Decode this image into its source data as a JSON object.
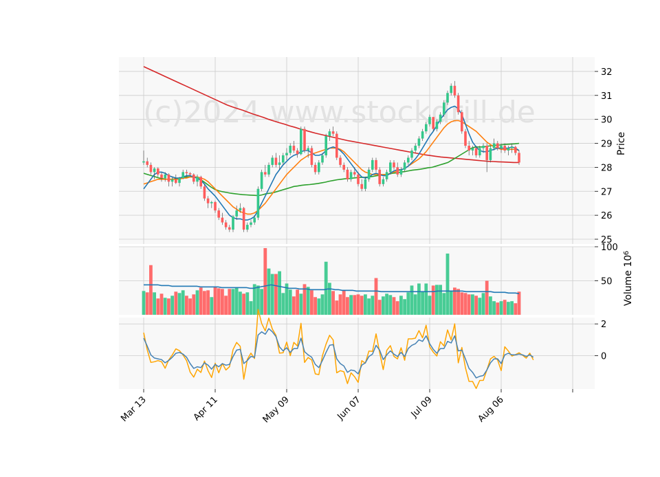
{
  "chart_data": {
    "type": "candlestick",
    "watermark": "(c)2024 www.stockdrill.de",
    "x_tick_labels": [
      "Mar 13",
      "Apr 11",
      "May 09",
      "Jun 07",
      "Jul 09",
      "Aug 06"
    ],
    "x_tick_index": [
      0,
      20,
      40,
      60,
      80,
      100,
      120
    ],
    "colors": {
      "up": "#34c78a",
      "down": "#ff5c5c",
      "ma_short": "#1f77b4",
      "ma_mid": "#ff7f0e",
      "ma_long": "#2ca02c",
      "ma_200": "#d62728",
      "vol_ma": "#1f77b4",
      "osc_a": "#4682b4",
      "osc_b": "#ffa500"
    },
    "price_panel": {
      "ylabel": "Price",
      "ylim": [
        24.8,
        32.6
      ],
      "yticks": [
        25,
        26,
        27,
        28,
        29,
        30,
        31,
        32
      ],
      "candles_ohlc": [
        [
          28.2,
          28.7,
          28.1,
          28.25
        ],
        [
          28.25,
          28.4,
          28.0,
          28.1
        ],
        [
          28.1,
          28.2,
          27.7,
          27.8
        ],
        [
          27.8,
          28.0,
          27.5,
          27.95
        ],
        [
          27.95,
          28.0,
          27.6,
          27.7
        ],
        [
          27.7,
          27.8,
          27.4,
          27.55
        ],
        [
          27.55,
          27.8,
          27.4,
          27.7
        ],
        [
          27.7,
          27.75,
          27.2,
          27.4
        ],
        [
          27.4,
          27.6,
          27.2,
          27.5
        ],
        [
          27.5,
          27.7,
          27.3,
          27.35
        ],
        [
          27.35,
          27.6,
          27.2,
          27.55
        ],
        [
          27.55,
          27.9,
          27.5,
          27.8
        ],
        [
          27.8,
          27.9,
          27.6,
          27.75
        ],
        [
          27.75,
          27.8,
          27.6,
          27.7
        ],
        [
          27.7,
          27.75,
          27.3,
          27.4
        ],
        [
          27.4,
          27.7,
          27.2,
          27.6
        ],
        [
          27.6,
          27.65,
          27.1,
          27.2
        ],
        [
          27.2,
          27.3,
          26.6,
          26.7
        ],
        [
          26.7,
          26.8,
          26.3,
          26.5
        ],
        [
          26.5,
          26.6,
          26.3,
          26.55
        ],
        [
          26.55,
          26.6,
          26.1,
          26.2
        ],
        [
          26.2,
          26.3,
          25.8,
          25.9
        ],
        [
          25.9,
          26.1,
          25.6,
          25.7
        ],
        [
          25.7,
          25.8,
          25.4,
          25.5
        ],
        [
          25.5,
          25.6,
          25.3,
          25.4
        ],
        [
          25.4,
          26.0,
          25.3,
          25.95
        ],
        [
          25.95,
          26.4,
          25.8,
          26.2
        ],
        [
          26.2,
          26.5,
          26.1,
          26.3
        ],
        [
          26.3,
          26.35,
          25.3,
          25.4
        ],
        [
          25.4,
          25.7,
          25.3,
          25.6
        ],
        [
          25.6,
          25.8,
          25.5,
          25.7
        ],
        [
          25.7,
          26.0,
          25.6,
          25.9
        ],
        [
          25.9,
          27.2,
          25.8,
          27.1
        ],
        [
          27.1,
          27.9,
          27.0,
          27.8
        ],
        [
          27.8,
          28.1,
          27.6,
          27.7
        ],
        [
          27.7,
          28.2,
          27.6,
          28.1
        ],
        [
          28.1,
          28.5,
          28.0,
          28.4
        ],
        [
          28.4,
          28.6,
          28.0,
          28.1
        ],
        [
          28.1,
          28.5,
          27.9,
          28.2
        ],
        [
          28.2,
          28.6,
          28.1,
          28.5
        ],
        [
          28.5,
          28.8,
          28.3,
          28.6
        ],
        [
          28.6,
          29.0,
          28.5,
          28.9
        ],
        [
          28.9,
          29.1,
          28.6,
          28.7
        ],
        [
          28.7,
          28.8,
          28.4,
          28.55
        ],
        [
          28.55,
          29.7,
          28.5,
          29.6
        ],
        [
          29.6,
          29.7,
          28.6,
          28.7
        ],
        [
          28.7,
          28.9,
          28.4,
          28.8
        ],
        [
          28.8,
          28.9,
          28.0,
          28.1
        ],
        [
          28.1,
          28.2,
          27.7,
          27.8
        ],
        [
          27.8,
          28.3,
          27.7,
          28.2
        ],
        [
          28.2,
          28.6,
          28.1,
          28.5
        ],
        [
          28.5,
          29.4,
          28.4,
          29.3
        ],
        [
          29.3,
          29.6,
          29.1,
          29.5
        ],
        [
          29.5,
          29.7,
          29.3,
          29.4
        ],
        [
          29.4,
          29.5,
          28.3,
          28.4
        ],
        [
          28.4,
          28.5,
          28.0,
          28.1
        ],
        [
          28.1,
          28.2,
          27.8,
          27.9
        ],
        [
          27.9,
          28.0,
          27.4,
          27.5
        ],
        [
          27.5,
          27.9,
          27.4,
          27.8
        ],
        [
          27.8,
          28.0,
          27.6,
          27.7
        ],
        [
          27.7,
          27.8,
          27.2,
          27.3
        ],
        [
          27.3,
          27.5,
          27.0,
          27.1
        ],
        [
          27.1,
          27.6,
          27.0,
          27.5
        ],
        [
          27.5,
          28.0,
          27.4,
          27.9
        ],
        [
          27.9,
          28.4,
          27.8,
          28.3
        ],
        [
          28.3,
          28.4,
          27.8,
          27.9
        ],
        [
          27.9,
          28.0,
          27.2,
          27.3
        ],
        [
          27.3,
          27.6,
          27.2,
          27.5
        ],
        [
          27.5,
          27.9,
          27.4,
          27.8
        ],
        [
          27.8,
          28.3,
          27.7,
          28.2
        ],
        [
          28.2,
          28.3,
          27.9,
          28.0
        ],
        [
          28.0,
          28.2,
          27.6,
          27.7
        ],
        [
          27.7,
          28.0,
          27.6,
          27.9
        ],
        [
          27.9,
          28.3,
          27.8,
          28.2
        ],
        [
          28.2,
          28.5,
          28.1,
          28.4
        ],
        [
          28.4,
          28.8,
          28.3,
          28.7
        ],
        [
          28.7,
          29.0,
          28.6,
          28.9
        ],
        [
          28.9,
          29.3,
          28.8,
          29.2
        ],
        [
          29.2,
          29.6,
          29.1,
          29.5
        ],
        [
          29.5,
          29.9,
          29.4,
          29.8
        ],
        [
          29.8,
          30.2,
          29.7,
          30.1
        ],
        [
          30.1,
          30.0,
          29.5,
          29.6
        ],
        [
          29.6,
          30.0,
          29.5,
          29.9
        ],
        [
          29.9,
          30.3,
          29.8,
          30.2
        ],
        [
          30.2,
          30.8,
          30.1,
          30.7
        ],
        [
          30.7,
          31.2,
          30.6,
          31.1
        ],
        [
          31.1,
          31.5,
          31.0,
          31.4
        ],
        [
          31.4,
          31.6,
          30.9,
          31.0
        ],
        [
          31.0,
          31.1,
          30.2,
          30.3
        ],
        [
          30.3,
          30.4,
          29.4,
          29.5
        ],
        [
          29.5,
          29.6,
          28.8,
          28.9
        ],
        [
          28.9,
          29.1,
          28.5,
          28.7
        ],
        [
          28.7,
          28.9,
          28.5,
          28.8
        ],
        [
          28.8,
          28.9,
          28.4,
          28.5
        ],
        [
          28.5,
          28.9,
          28.4,
          28.8
        ],
        [
          28.8,
          29.0,
          28.6,
          28.9
        ],
        [
          28.9,
          29.0,
          27.8,
          28.3
        ],
        [
          28.3,
          28.9,
          28.2,
          28.8
        ],
        [
          28.8,
          29.2,
          28.7,
          29.0
        ],
        [
          29.0,
          29.1,
          28.7,
          28.8
        ],
        [
          28.8,
          29.0,
          28.6,
          28.9
        ],
        [
          28.9,
          29.0,
          28.6,
          28.7
        ],
        [
          28.7,
          28.9,
          28.5,
          28.8
        ],
        [
          28.8,
          29.0,
          28.6,
          28.85
        ],
        [
          28.85,
          28.9,
          28.5,
          28.6
        ],
        [
          28.6,
          28.7,
          28.1,
          28.2
        ]
      ],
      "ma_short": [
        27.1,
        27.3,
        27.5,
        27.7,
        27.8,
        27.8,
        27.75,
        27.65,
        27.6,
        27.55,
        27.55,
        27.6,
        27.65,
        27.65,
        27.6,
        27.55,
        27.45,
        27.3,
        27.1,
        26.95,
        26.8,
        26.6,
        26.4,
        26.2,
        26.0,
        25.9,
        25.85,
        25.85,
        25.8,
        25.8,
        25.85,
        25.95,
        26.2,
        26.5,
        26.8,
        27.1,
        27.4,
        27.7,
        27.9,
        28.1,
        28.25,
        28.4,
        28.5,
        28.55,
        28.65,
        28.7,
        28.7,
        28.6,
        28.5,
        28.5,
        28.55,
        28.7,
        28.8,
        28.85,
        28.8,
        28.7,
        28.55,
        28.35,
        28.15,
        27.95,
        27.75,
        27.6,
        27.55,
        27.6,
        27.7,
        27.75,
        27.7,
        27.65,
        27.65,
        27.75,
        27.85,
        27.9,
        27.9,
        27.95,
        28.05,
        28.2,
        28.35,
        28.55,
        28.8,
        29.05,
        29.3,
        29.5,
        29.75,
        30.0,
        30.2,
        30.4,
        30.5,
        30.55,
        30.45,
        30.2,
        29.8,
        29.4,
        29.05,
        28.85,
        28.7,
        28.65,
        28.65,
        28.7,
        28.75,
        28.8,
        28.8,
        28.8,
        28.8,
        28.85,
        28.8,
        28.7
      ],
      "ma_mid": [
        27.3,
        27.35,
        27.4,
        27.45,
        27.5,
        27.5,
        27.5,
        27.5,
        27.5,
        27.5,
        27.5,
        27.55,
        27.55,
        27.6,
        27.6,
        27.6,
        27.55,
        27.5,
        27.4,
        27.25,
        27.1,
        26.95,
        26.8,
        26.65,
        26.5,
        26.35,
        26.25,
        26.15,
        26.1,
        26.05,
        26.05,
        26.1,
        26.2,
        26.35,
        26.5,
        26.7,
        26.9,
        27.1,
        27.3,
        27.5,
        27.7,
        27.85,
        28.0,
        28.15,
        28.3,
        28.4,
        28.5,
        28.55,
        28.6,
        28.65,
        28.7,
        28.75,
        28.8,
        28.8,
        28.8,
        28.75,
        28.65,
        28.5,
        28.35,
        28.2,
        28.05,
        27.9,
        27.8,
        27.75,
        27.7,
        27.7,
        27.7,
        27.7,
        27.7,
        27.75,
        27.8,
        27.85,
        27.9,
        27.95,
        28.05,
        28.15,
        28.25,
        28.35,
        28.5,
        28.65,
        28.85,
        29.05,
        29.25,
        29.45,
        29.65,
        29.8,
        29.9,
        29.95,
        29.95,
        29.9,
        29.8,
        29.7,
        29.6,
        29.5,
        29.35,
        29.2,
        29.05,
        28.95,
        28.85,
        28.8,
        28.75,
        28.75,
        28.75,
        28.75,
        28.75,
        28.7
      ],
      "ma_long": [
        27.75,
        27.7,
        27.65,
        27.6,
        27.55,
        27.52,
        27.5,
        27.5,
        27.52,
        27.55,
        27.57,
        27.6,
        27.6,
        27.58,
        27.52,
        27.42,
        27.3,
        27.18,
        27.08,
        27.02,
        26.98,
        26.95,
        26.92,
        26.9,
        26.88,
        26.86,
        26.85,
        26.84,
        26.83,
        26.82,
        26.85,
        26.9,
        26.92,
        26.95,
        27.0,
        27.05,
        27.1,
        27.15,
        27.2,
        27.22,
        27.25,
        27.27,
        27.28,
        27.3,
        27.32,
        27.35,
        27.38,
        27.42,
        27.45,
        27.48,
        27.5,
        27.52,
        27.53,
        27.55,
        27.57,
        27.58,
        27.58,
        27.6,
        27.62,
        27.65,
        27.67,
        27.7,
        27.72,
        27.75,
        27.77,
        27.8,
        27.82,
        27.85,
        27.88,
        27.9,
        27.92,
        27.95,
        27.98,
        28.0,
        28.05,
        28.1,
        28.15,
        28.2,
        28.3,
        28.4,
        28.5,
        28.6,
        28.7,
        28.8,
        28.85,
        28.85,
        28.85,
        28.88,
        28.9,
        28.92,
        28.93,
        28.95,
        28.96,
        28.97,
        28.98,
        29.0
      ],
      "ma_200": [
        32.2,
        32.1,
        32.0,
        31.9,
        31.8,
        31.7,
        31.6,
        31.5,
        31.4,
        31.3,
        31.2,
        31.1,
        31.0,
        30.9,
        30.8,
        30.7,
        30.6,
        30.52,
        30.45,
        30.38,
        30.3,
        30.22,
        30.15,
        30.08,
        30.0,
        29.93,
        29.86,
        29.8,
        29.73,
        29.67,
        29.6,
        29.54,
        29.48,
        29.42,
        29.37,
        29.32,
        29.27,
        29.22,
        29.17,
        29.12,
        29.08,
        29.04,
        29.0,
        28.96,
        28.92,
        28.88,
        28.84,
        28.8,
        28.76,
        28.72,
        28.68,
        28.64,
        28.6,
        28.56,
        28.52,
        28.49,
        28.46,
        28.43,
        28.41,
        28.39,
        28.37,
        28.35,
        28.33,
        28.31,
        28.29,
        28.27,
        28.25,
        28.24,
        28.23,
        28.22,
        28.21,
        28.2,
        28.2
      ]
    },
    "volume_panel": {
      "ylabel": "Volume  10",
      "ylabel_exp": "6",
      "ylim": [
        0,
        100
      ],
      "yticks": [
        50,
        100
      ],
      "values": [
        35,
        33,
        73,
        33,
        24,
        31,
        25,
        24,
        28,
        34,
        32,
        36,
        28,
        24,
        30,
        36,
        40,
        35,
        36,
        26,
        41,
        39,
        38,
        28,
        38,
        38,
        40,
        34,
        31,
        33,
        20,
        45,
        43,
        38,
        98,
        68,
        60,
        60,
        64,
        32,
        46,
        37,
        27,
        37,
        31,
        45,
        41,
        36,
        26,
        24,
        30,
        78,
        47,
        35,
        21,
        30,
        36,
        26,
        29,
        29,
        30,
        28,
        30,
        24,
        28,
        54,
        22,
        27,
        31,
        29,
        26,
        20,
        28,
        23,
        33,
        43,
        30,
        46,
        34,
        46,
        28,
        43,
        44,
        44,
        32,
        90,
        35,
        40,
        38,
        33,
        32,
        30,
        30,
        28,
        25,
        32,
        50,
        27,
        20,
        18,
        20,
        22,
        19,
        20,
        17,
        34,
        37
      ],
      "ma": [
        44,
        44,
        44,
        44,
        44,
        43,
        43,
        43,
        42,
        42,
        42,
        42,
        42,
        42,
        42,
        42,
        41,
        41,
        41,
        41,
        41,
        41,
        40,
        40,
        40,
        40,
        40,
        40,
        40,
        40,
        39,
        39,
        40,
        41,
        42,
        43,
        44,
        43,
        42,
        41,
        40,
        39,
        39,
        39,
        38,
        38,
        38,
        37,
        37,
        37,
        37,
        37,
        38,
        38,
        37,
        37,
        36,
        36,
        36,
        36,
        35,
        35,
        35,
        35,
        35,
        35,
        35,
        34,
        34,
        34,
        34,
        34,
        34,
        34,
        34,
        34,
        34,
        34,
        34,
        34,
        34,
        34,
        34,
        35,
        35,
        35,
        35,
        35,
        35,
        35,
        35,
        34,
        34,
        34,
        34,
        34,
        34,
        34,
        34,
        33,
        33,
        33,
        33,
        32,
        32,
        32,
        31
      ]
    },
    "oscillator_panel": {
      "ylim": [
        -2.1,
        2.4
      ],
      "yticks": [
        0,
        2
      ],
      "ytick_labels": [
        "0",
        "2"
      ],
      "series_a": [
        1.1,
        0.6,
        0.05,
        -0.15,
        -0.2,
        -0.25,
        -0.45,
        -0.3,
        -0.1,
        0.15,
        0.2,
        0.1,
        -0.1,
        -0.5,
        -0.8,
        -0.7,
        -0.75,
        -0.45,
        -0.6,
        -0.85,
        -0.55,
        -0.7,
        -0.5,
        -0.6,
        -0.55,
        -0.05,
        0.35,
        0.4,
        -0.5,
        -0.3,
        -0.05,
        -0.1,
        1.3,
        1.5,
        1.35,
        1.7,
        1.5,
        1.2,
        0.55,
        0.3,
        0.5,
        0.2,
        0.45,
        0.45,
        1.1,
        0.25,
        0.05,
        -0.1,
        -0.55,
        -0.75,
        -0.3,
        0.2,
        0.65,
        0.7,
        -0.2,
        -0.5,
        -0.65,
        -1.05,
        -0.9,
        -0.95,
        -1.15,
        -0.6,
        -0.45,
        -0.05,
        0.1,
        0.65,
        0.35,
        -0.25,
        0.05,
        0.3,
        0.1,
        -0.05,
        0.2,
        -0.05,
        0.45,
        0.65,
        0.75,
        1.0,
        0.9,
        1.25,
        0.75,
        0.4,
        0.15,
        0.45,
        0.45,
        0.9,
        0.8,
        1.25,
        0.3,
        0.35,
        -0.2,
        -0.8,
        -1.05,
        -1.4,
        -1.3,
        -1.25,
        -0.9,
        -0.45,
        -0.2,
        -0.2,
        -0.5,
        0.05,
        0.15,
        0.05,
        0.05,
        0.1,
        0.05,
        -0.05,
        0.05,
        -0.1
      ]
    }
  }
}
